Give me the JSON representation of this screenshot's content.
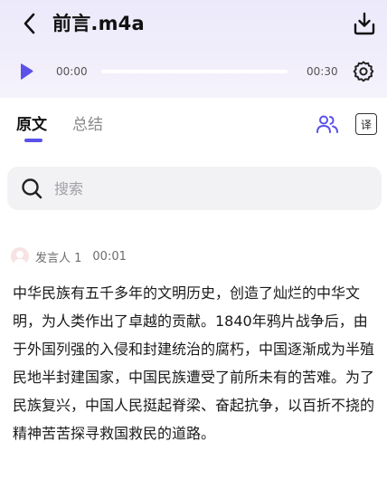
{
  "header": {
    "title": "前言.m4a"
  },
  "player": {
    "current_time": "00:00",
    "total_time": "00:30",
    "progress": 0.0
  },
  "tabs": {
    "items": [
      {
        "label": "原文",
        "active": true
      },
      {
        "label": "总结",
        "active": false
      }
    ],
    "translate_label": "译"
  },
  "search": {
    "placeholder": "搜索",
    "value": ""
  },
  "transcript": {
    "speaker": "发言人 1",
    "timestamp": "00:01",
    "text": "中华民族有五千多年的文明历史，创造了灿烂的中华文明，为人类作出了卓越的贡献。1840年鸦片战争后，由于外国列强的入侵和封建统治的腐朽，中国逐渐成为半殖民地半封建国家，中国民族遭受了前所未有的苦难。为了民族复兴，中国人民挺起脊梁、奋起抗争，以百折不挠的精神苦苦探寻救国救民的道路。"
  },
  "colors": {
    "accent": "#5b52e8",
    "header_bg": "#ece9fb",
    "search_bg": "#f2f2f4"
  },
  "icons": {
    "back": "chevron-left-icon",
    "download": "download-icon",
    "play": "play-icon",
    "settings": "gear-icon",
    "speakers": "users-icon",
    "search": "search-icon",
    "avatar": "avatar-icon"
  }
}
